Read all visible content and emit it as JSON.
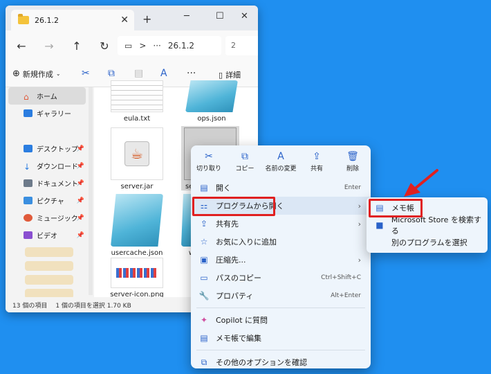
{
  "window": {
    "tab_title": "26.1.2",
    "tab_close": "✕",
    "tab_add": "+",
    "minimize": "─",
    "maximize": "☐",
    "close": "✕",
    "nav_more": "···",
    "nav_chevron": ">",
    "address": "26.1.2",
    "search": "2"
  },
  "toolbar": {
    "new_label": "新規作成",
    "details_label": "詳細"
  },
  "sidebar": {
    "home": "ホーム",
    "gallery": "ギャラリー",
    "quick": [
      {
        "label": "デスクトップ",
        "color": "#2b7de0"
      },
      {
        "label": "ダウンロード",
        "color": "#2b7de0"
      },
      {
        "label": "ドキュメント",
        "color": "#6d7a8a"
      },
      {
        "label": "ピクチャ",
        "color": "#3b8fe0"
      },
      {
        "label": "ミュージック",
        "color": "#e05a3a"
      },
      {
        "label": "ビデオ",
        "color": "#8a4fd0"
      }
    ]
  },
  "files": [
    {
      "name": "eula.txt"
    },
    {
      "name": "ops.json"
    },
    {
      "name": "server.jar"
    },
    {
      "name": "serv"
    },
    {
      "name": "usercache.json"
    },
    {
      "name": "w"
    },
    {
      "name": "server-icon.png"
    }
  ],
  "status": {
    "count": "13 個の項目",
    "selected": "1 個の項目を選択  1.70 KB"
  },
  "menu": {
    "quick": [
      {
        "icon": "✂",
        "label": "切り取り"
      },
      {
        "icon": "⧉",
        "label": "コピー"
      },
      {
        "icon": "A",
        "label": "名前の変更"
      },
      {
        "icon": "⇪",
        "label": "共有"
      },
      {
        "icon": "🗑",
        "label": "削除"
      }
    ],
    "open": "開く",
    "open_shortcut": "Enter",
    "open_with": "プログラムから開く",
    "share_with": "共有先",
    "favorite": "お気に入りに追加",
    "compress": "圧縮先...",
    "copy_path": "パスのコピー",
    "copy_path_shortcut": "Ctrl+Shift+C",
    "properties": "プロパティ",
    "properties_shortcut": "Alt+Enter",
    "copilot": "Copilot に質問",
    "notepad_edit": "メモ帳で編集",
    "more": "その他のオプションを確認"
  },
  "submenu": {
    "notepad": "メモ帳",
    "store": "Microsoft Store を検索する",
    "other": "別のプログラムを選択"
  },
  "colors": {
    "highlight": "#e02020",
    "background": "#1f8ff0"
  }
}
